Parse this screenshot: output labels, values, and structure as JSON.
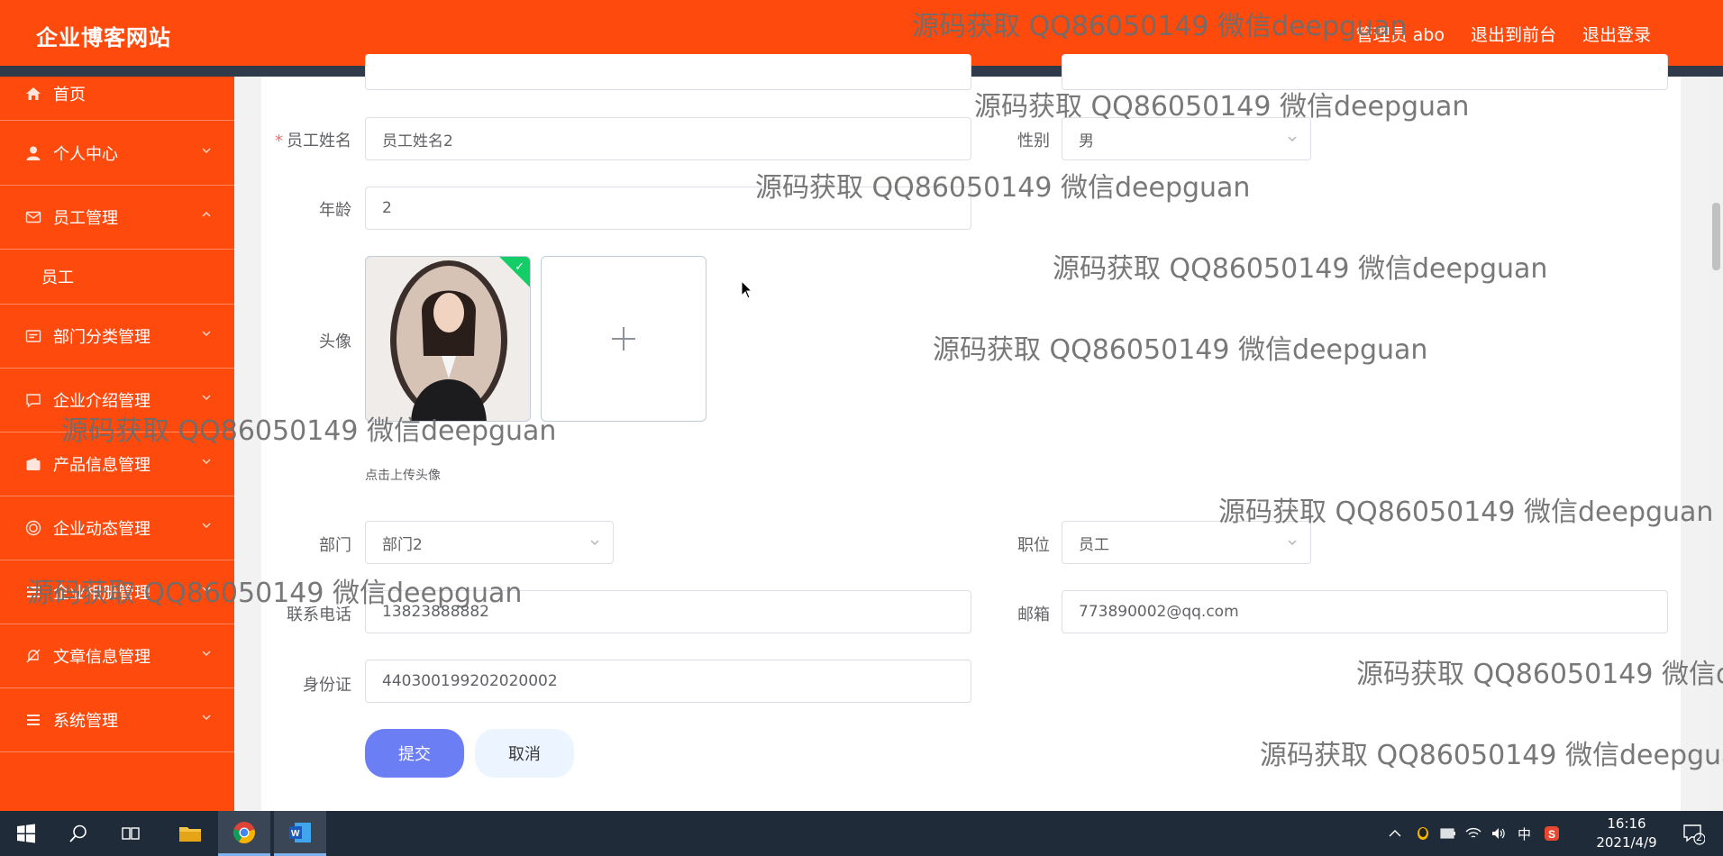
{
  "header": {
    "brand": "企业博客网站",
    "nav": [
      "管理员 abo",
      "退出到前台",
      "退出登录"
    ]
  },
  "sidebar": {
    "items": [
      {
        "label": "首页",
        "icon": "home-icon"
      },
      {
        "label": "个人中心",
        "icon": "user-icon"
      },
      {
        "label": "员工管理",
        "icon": "mail-icon"
      },
      {
        "label": "部门分类管理",
        "icon": "card-icon"
      },
      {
        "label": "企业介绍管理",
        "icon": "chat-icon"
      },
      {
        "label": "产品信息管理",
        "icon": "wallet-icon"
      },
      {
        "label": "企业动态管理",
        "icon": "target-icon"
      },
      {
        "label": "企业相册管理",
        "icon": "list-icon"
      },
      {
        "label": "文章信息管理",
        "icon": "bell-off-icon"
      },
      {
        "label": "系统管理",
        "icon": "menu-icon"
      }
    ],
    "sub": {
      "label": "员工"
    }
  },
  "form": {
    "name": {
      "label": "员工姓名",
      "value": "员工姓名2"
    },
    "gender": {
      "label": "性别",
      "value": "男"
    },
    "age": {
      "label": "年龄",
      "value": "2"
    },
    "avatar": {
      "label": "头像",
      "hint": "点击上传头像"
    },
    "department": {
      "label": "部门",
      "value": "部门2"
    },
    "position": {
      "label": "职位",
      "value": "员工"
    },
    "phone": {
      "label": "联系电话",
      "value": "13823888882"
    },
    "email": {
      "label": "邮箱",
      "value": "773890002@qq.com"
    },
    "id_card": {
      "label": "身份证",
      "value": "440300199202020002"
    },
    "submit_label": "提交",
    "cancel_label": "取消"
  },
  "watermark": "源码获取 QQ86050149 微信deepguan",
  "taskbar": {
    "ime": "中",
    "time": "16:16",
    "date": "2021/4/9",
    "notifications": "2"
  },
  "colors": {
    "brand": "#ff4a0e",
    "strip": "#2f3a4a",
    "submit": "#6c7ef3",
    "cancel_bg": "#ecf5ff",
    "success": "#13ce66"
  }
}
